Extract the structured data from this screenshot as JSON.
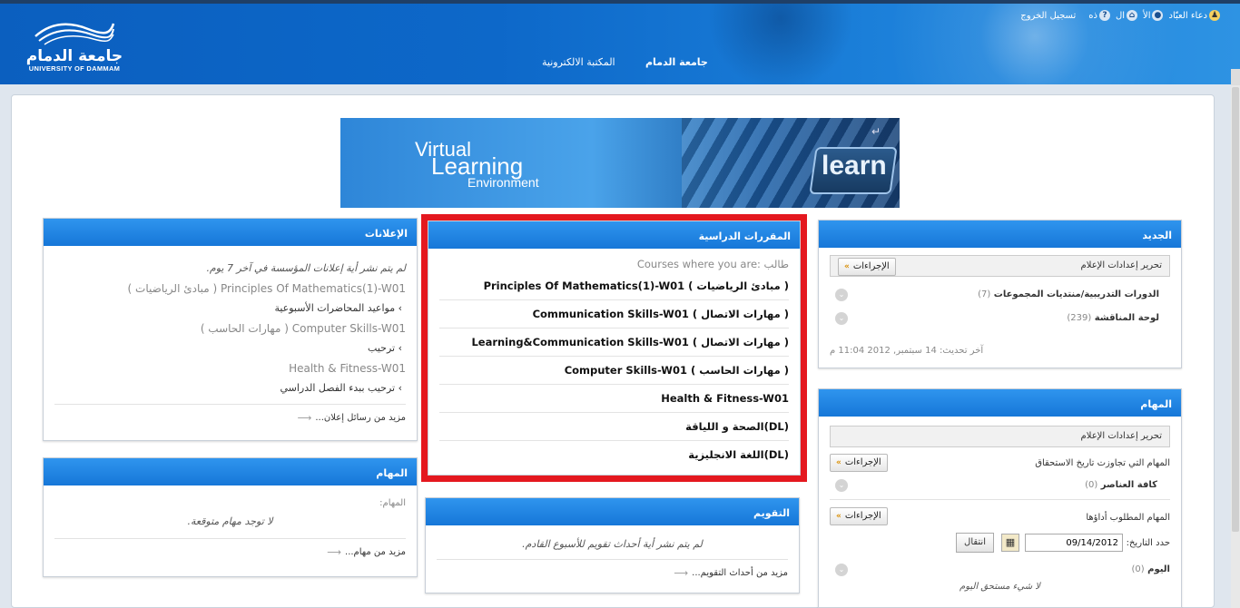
{
  "header": {
    "logo_ar": "جامعة الدمام",
    "logo_en": "UNIVERSITY OF DAMMAM",
    "user_bar": {
      "user_name": "دعاء العبّاد",
      "my_places": "الأ",
      "home": "ال",
      "help": "ذه",
      "logout": "تسجيل الخروج"
    },
    "nav": {
      "university": "جامعة الدمام",
      "library": "المكتبة الالكترونية"
    }
  },
  "banner": {
    "line1": "Virtual",
    "line2": "Learning",
    "line3": "Environment",
    "key": "learn"
  },
  "announcements": {
    "title": "الإعلانات",
    "none_msg": "لم يتم نشر أية إعلانات المؤسسة في آخر 7 يوم.",
    "groups": [
      {
        "course": "Principles Of Mathematics(1)-W01 ( مبادئ الرياضيات )",
        "item": "مواعيد المحاضرات الأسبوعية"
      },
      {
        "course": "Computer Skills-W01 ( مهارات الحاسب )",
        "item": "ترحيب"
      },
      {
        "course": "Health & Fitness-W01",
        "item": "ترحيب ببدء الفصل الدراسي"
      }
    ],
    "more": "مزيد من رسائل إعلان..."
  },
  "tasks_left": {
    "title": "المهام",
    "label": "المهام:",
    "none_msg": "لا توجد مهام متوقعة.",
    "more": "مزيد من مهام..."
  },
  "courses": {
    "title": "المقررات الدراسية",
    "subtitle": "Courses where you are: طالب",
    "items": [
      "Principles Of Mathematics(1)-W01 ( مبادئ الرياضيات )",
      "Communication Skills-W01 ( مهارات الاتصال )",
      "Learning&Communication Skills-W01 ( مهارات الاتصال )",
      "Computer Skills-W01 ( مهارات الحاسب )",
      "Health & Fitness-W01",
      "الصحة و اللياقة(DL)",
      "اللغة الانجليزية(DL)"
    ]
  },
  "calendar": {
    "title": "التقويم",
    "none_msg": "لم يتم نشر أية أحداث تقويم للأسبوع القادم.",
    "more": "مزيد من أحداث التقويم..."
  },
  "whats_new": {
    "title": "الجديد",
    "edit": "تحرير إعدادات الإعلام",
    "actions": "الإجراءات",
    "rows": [
      {
        "label": "الدورات التدريبية/منتديات المجموعات",
        "count": "(7)"
      },
      {
        "label": "لوحة المناقشة",
        "count": "(239)"
      }
    ],
    "updated": "آخر تحديث: 14 سبتمبر, 2012 11:04 م"
  },
  "tasks_right": {
    "title": "المهام",
    "edit": "تحرير إعدادات الإعلام",
    "past_due": "المهام التي تجاوزت تاريخ الاستحقاق",
    "actions": "الإجراءات",
    "all_items": "كافة العناصر",
    "all_items_count": "(0)",
    "needed": "المهام المطلوب أداؤها",
    "date_label": "حدد التاريخ:",
    "date_value": "09/14/2012",
    "go": "انتقال",
    "today": "اليوم",
    "today_count": "(0)",
    "nothing_due": "لا شيء مستحق اليوم"
  }
}
